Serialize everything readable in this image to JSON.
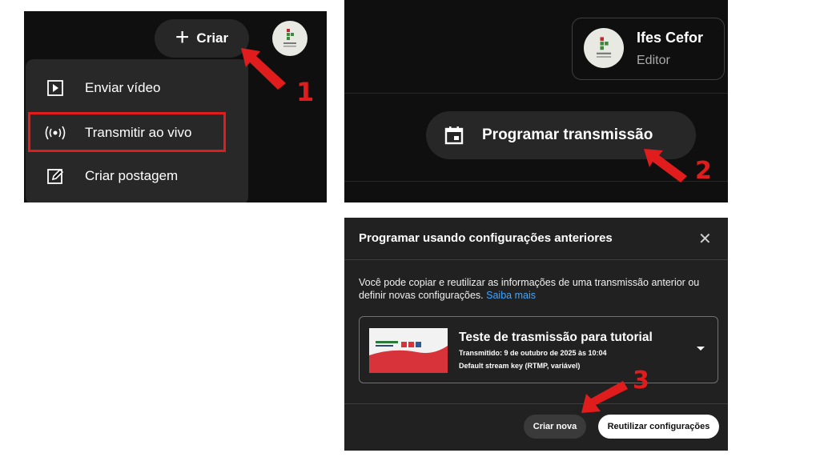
{
  "colors": {
    "annotation": "#e01c1c",
    "link": "#3ea6ff",
    "dark_bg": "#0f0f0f"
  },
  "panel1": {
    "create_button": {
      "label": "Criar",
      "icon": "plus-icon"
    },
    "avatar": {
      "icon": "ifes-logo-icon"
    },
    "menu": [
      {
        "label": "Enviar vídeo",
        "icon": "upload-video-icon"
      },
      {
        "label": "Transmitir ao vivo",
        "icon": "live-broadcast-icon",
        "highlighted": true
      },
      {
        "label": "Criar postagem",
        "icon": "create-post-icon"
      }
    ],
    "step_number": "1"
  },
  "panel2": {
    "account": {
      "name": "Ifes Cefor",
      "role": "Editor"
    },
    "schedule_button": {
      "label": "Programar transmissão",
      "icon": "calendar-icon"
    },
    "step_number": "2"
  },
  "panel3": {
    "dialog_title": "Programar usando configurações anteriores",
    "description": "Você pode copiar e reutilizar as informações de uma transmissão anterior ou definir novas configurações.",
    "learn_more": "Saiba mais",
    "stream": {
      "title": "Teste de trasmissão para tutorial",
      "transmitted": "Transmitido: 9 de outubro de 2025 às 10:04",
      "stream_key": "Default stream key (RTMP, variável)"
    },
    "buttons": {
      "create_new": "Criar nova",
      "reuse": "Reutilizar configurações"
    },
    "step_number": "3"
  }
}
